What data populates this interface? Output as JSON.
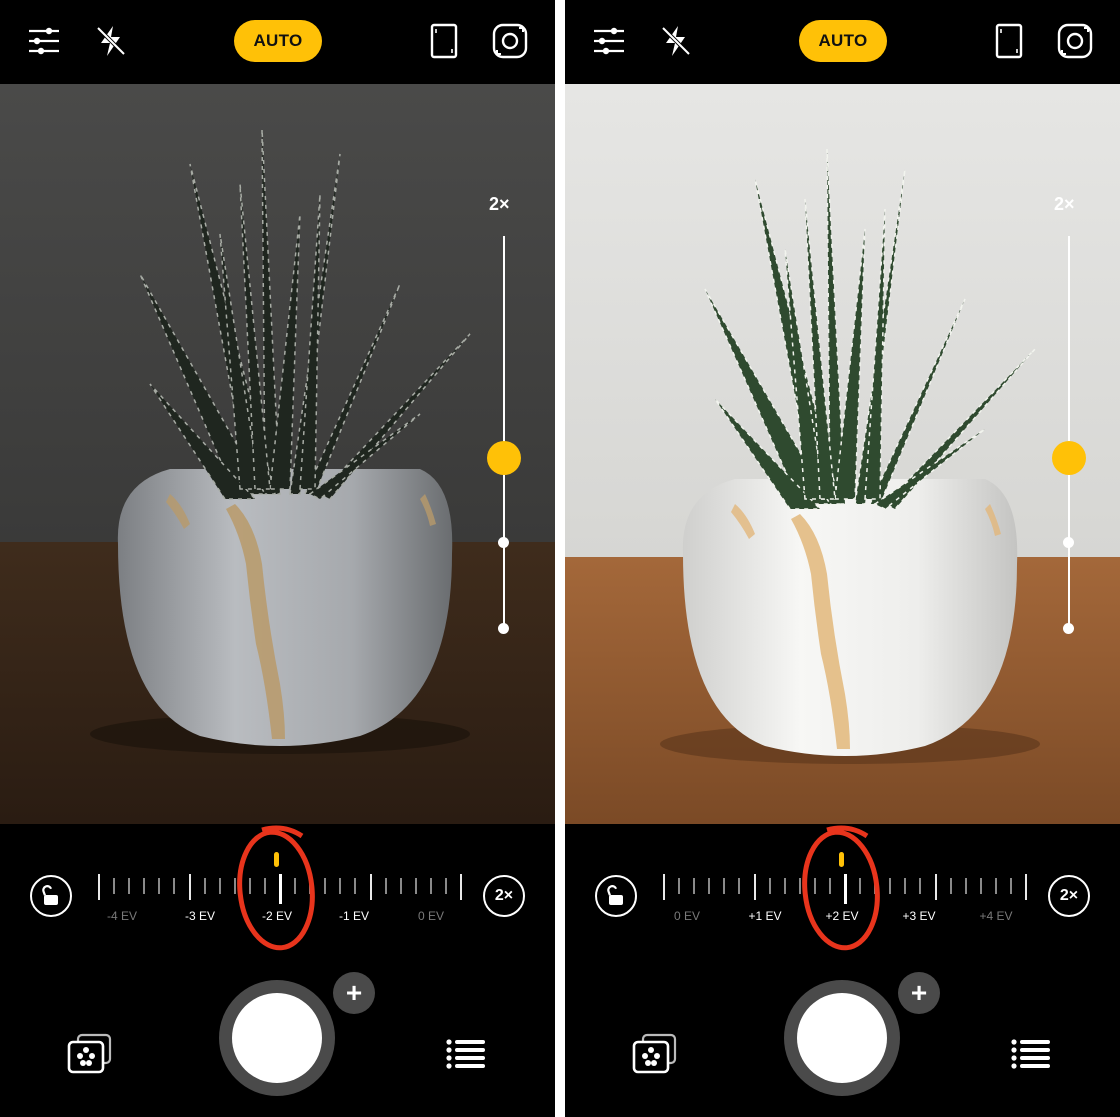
{
  "colors": {
    "accent": "#ffc107",
    "annotation": "#e8341c",
    "background": "#000000"
  },
  "top_bar": {
    "icons": [
      "settings-sliders-icon",
      "flash-off-icon",
      "aspect-ratio-icon",
      "switch-camera-icon"
    ],
    "mode_label": "AUTO"
  },
  "screens": [
    {
      "zoom_slider": {
        "label": "2×",
        "level": 0.5
      },
      "ev_dial": {
        "labels": [
          "-4 EV",
          "-3 EV",
          "-2 EV",
          "-1 EV",
          "0 EV"
        ],
        "selected": "-2 EV",
        "zoom_button": "2×"
      },
      "lighting": "dark"
    },
    {
      "zoom_slider": {
        "label": "2×",
        "level": 0.5
      },
      "ev_dial": {
        "labels": [
          "0 EV",
          "+1 EV",
          "+2 EV",
          "+3 EV",
          "+4 EV"
        ],
        "selected": "+2 EV",
        "zoom_button": "2×"
      },
      "lighting": "bright"
    }
  ],
  "bottom_bar": {
    "shutter": "shutter-button",
    "add_label": "+"
  }
}
